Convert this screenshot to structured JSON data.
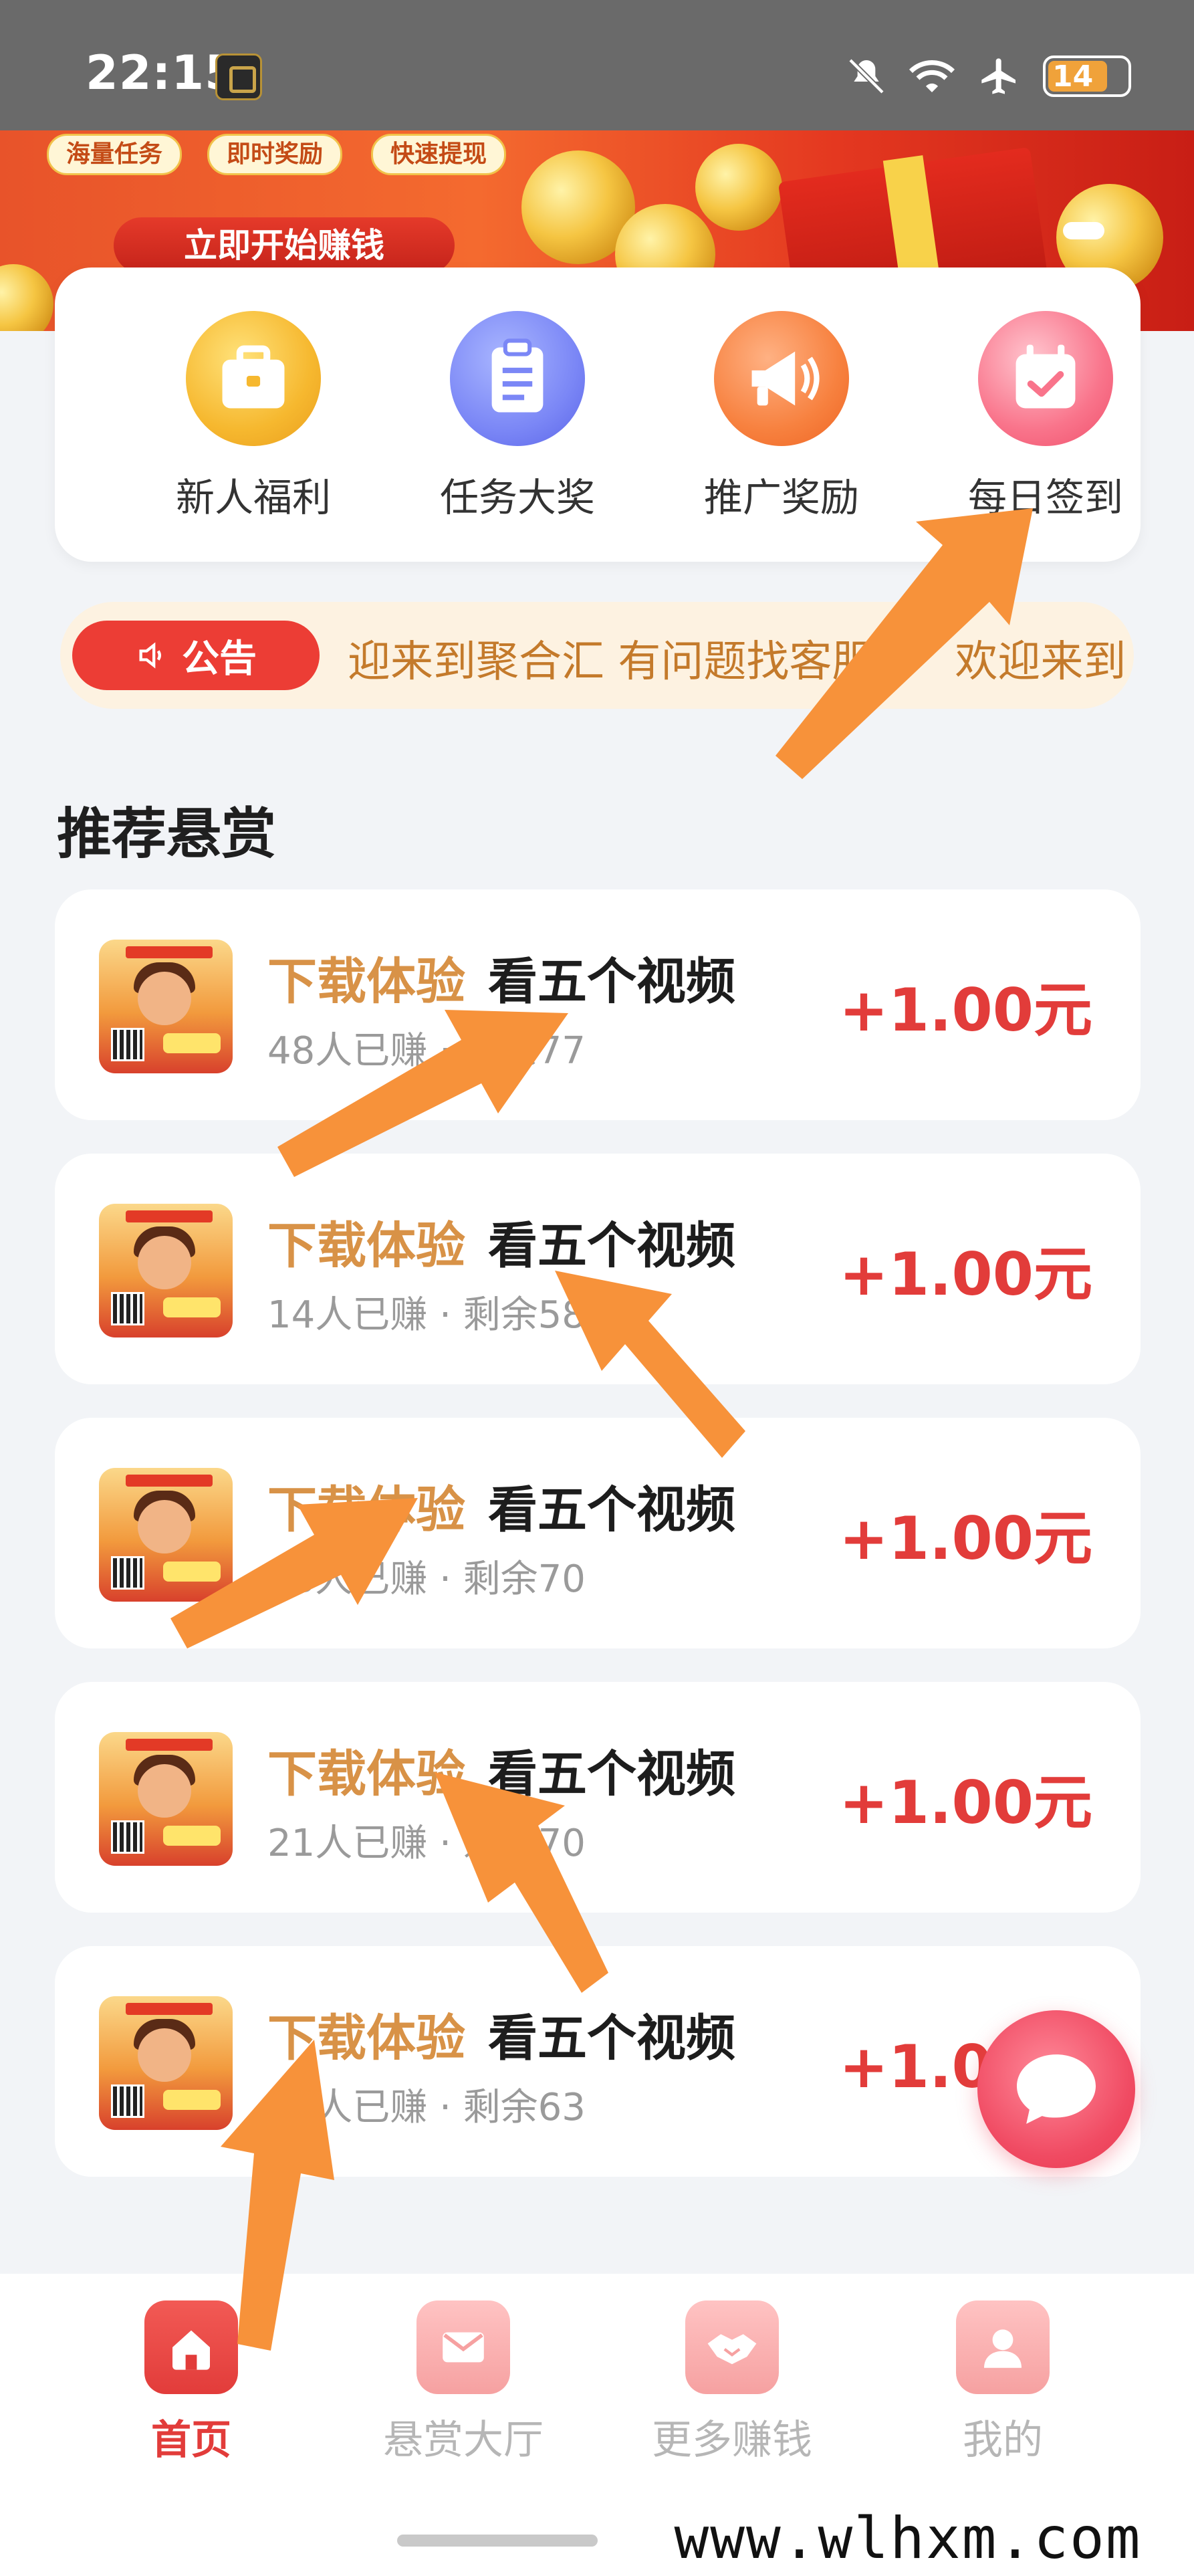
{
  "status_bar": {
    "time": "22:15",
    "battery": "14"
  },
  "banner": {
    "tags": [
      "海量任务",
      "即时奖励",
      "快速提现"
    ],
    "cta_label": "立即开始赚钱"
  },
  "quick_actions": [
    {
      "label": "新人福利",
      "icon": "briefcase-icon",
      "color": "#f6b82f"
    },
    {
      "label": "任务大奖",
      "icon": "clipboard-icon",
      "color": "#7b87f6"
    },
    {
      "label": "推广奖励",
      "icon": "megaphone-icon",
      "color": "#f7813f"
    },
    {
      "label": "每日签到",
      "icon": "calendar-check-icon",
      "color": "#f9748b"
    }
  ],
  "notice": {
    "badge": "公告",
    "text": "迎来到聚合汇 有问题找客服",
    "text_repeat": "欢迎来到"
  },
  "section": {
    "title": "推荐悬赏"
  },
  "tasks": [
    {
      "prefix": "下载体验",
      "title": "看五个视频",
      "earned": "48人已赚",
      "remaining": "剩余77",
      "reward": "+1.00元"
    },
    {
      "prefix": "下载体验",
      "title": "看五个视频",
      "earned": "14人已赚",
      "remaining": "剩余58",
      "reward": "+1.00元"
    },
    {
      "prefix": "下载体验",
      "title": "看五个视频",
      "earned": "18人已赚",
      "remaining": "剩余70",
      "reward": "+1.00元"
    },
    {
      "prefix": "下载体验",
      "title": "看五个视频",
      "earned": "21人已赚",
      "remaining": "剩余70",
      "reward": "+1.00元"
    },
    {
      "prefix": "下载体验",
      "title": "看五个视频",
      "earned": "16人已赚",
      "remaining": "剩余63",
      "reward": "+1.00元"
    }
  ],
  "separator": " · ",
  "bottom_nav": [
    {
      "label": "首页",
      "active": true,
      "icon": "home-icon"
    },
    {
      "label": "悬赏大厅",
      "active": false,
      "icon": "mail-icon"
    },
    {
      "label": "更多赚钱",
      "active": false,
      "icon": "handshake-icon"
    },
    {
      "label": "我的",
      "active": false,
      "icon": "user-icon"
    }
  ],
  "watermark": "www.wlhxm.com",
  "colors": {
    "accent_red": "#e23c3a",
    "prefix_orange": "#d89247",
    "annotation_arrow": "#f7923a"
  }
}
